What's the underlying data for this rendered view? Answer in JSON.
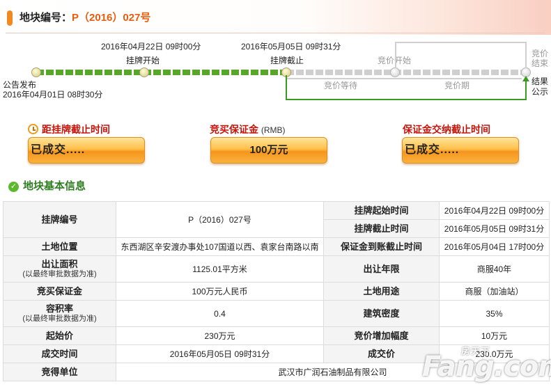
{
  "header": {
    "label": "地块编号：",
    "code": "P（2016）027号"
  },
  "timeline": {
    "listing_start_time": "2016年04月22日  09时00分",
    "listing_start_label": "挂牌开始",
    "listing_end_time": "2016年05月05日  09时31分",
    "listing_end_label": "挂牌截止",
    "announce_label": "公告发布",
    "announce_time": "2016年04月01日  08时30分",
    "bid_start_label": "竞价开始",
    "bid_end_label_1": "竞价",
    "bid_end_label_2": "结束",
    "bid_wait_label": "竞价等待",
    "bid_period_label": "竞价期",
    "result_label_1": "结果",
    "result_label_2": "公示"
  },
  "countdown": {
    "deadline_label": "距挂牌截止时间",
    "deadline_value": "已成交.....",
    "deposit_label": "竞买保证金",
    "deposit_unit": "(RMB)",
    "deposit_value": "100万元",
    "pay_deadline_label": "保证金交纳截止时间",
    "pay_deadline_value": "已成交....."
  },
  "section": {
    "title": "地块基本信息"
  },
  "table": {
    "r1_h1": "挂牌编号",
    "r1_v1": "P（2016）027号",
    "r1_h2": "挂牌起始时间",
    "r1_v2": "2016年04月22日  09时00分",
    "r2_h2": "挂牌截止时间",
    "r2_v2": "2016年05月05日  09时31分",
    "r3_h1": "土地位置",
    "r3_v1": "东西湖区辛安渡办事处107国道以西、袁家台南路以南",
    "r3_h2": "保证金到账截止时间",
    "r3_v2": "2016年05月04日  17时00分",
    "r4_h1": "出让面积",
    "r4_h1_sub": "(以最终审批数据为准)",
    "r4_v1": "1125.01平方米",
    "r4_h2": "出让年限",
    "r4_v2": "商服40年",
    "r5_h1": "竞买保证金",
    "r5_v1": "100万元人民币",
    "r5_h2": "土地用途",
    "r5_v2": "商服（加油站）",
    "r6_h1": "容积率",
    "r6_h1_sub": "(以最终审批数据为准)",
    "r6_v1": "0.4",
    "r6_h2": "建筑密度",
    "r6_v2": "35%",
    "r7_h1": "起始价",
    "r7_v1": "230万元",
    "r7_h2": "竞价增加幅度",
    "r7_v2": "10万元",
    "r8_h1": "成交时间",
    "r8_v1": "2016年05月05日  09时31分",
    "r8_h2": "成交价",
    "r8_v2": "230.0万元",
    "r9_h1": "竞得单位",
    "r9_v1": "武汉市广润石油制品有限公司"
  },
  "watermark": {
    "small": "房天下",
    "big": "Fang.com"
  }
}
